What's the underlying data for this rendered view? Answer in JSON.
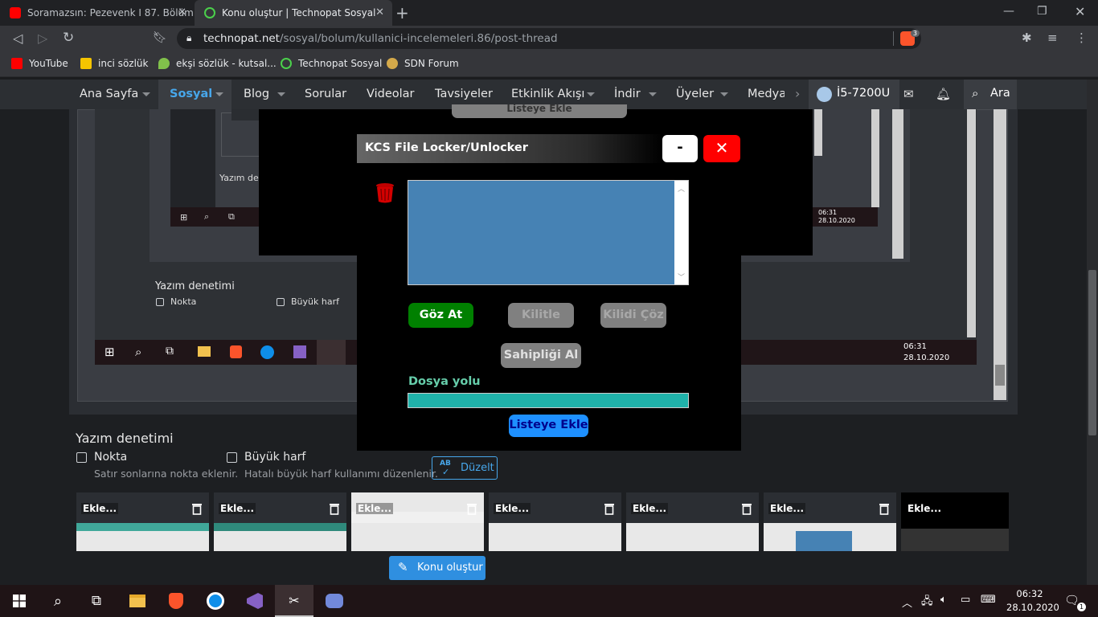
{
  "browser": {
    "tabs": [
      {
        "title": "Soramazsın: Pezevenk I 87. Bölüm"
      },
      {
        "title": "Konu oluştur | Technopat Sosyal"
      }
    ],
    "url_host": "technopat.net",
    "url_path": "/sosyal/bolum/kullanici-incelemeleri.86/post-thread",
    "shield_count": "3",
    "bookmarks": [
      {
        "label": "YouTube"
      },
      {
        "label": "inci sözlük"
      },
      {
        "label": "ekşi sözlük - kutsal..."
      },
      {
        "label": "Technopat Sosyal"
      },
      {
        "label": "SDN Forum"
      }
    ]
  },
  "site": {
    "nav": [
      "Ana Sayfa",
      "Sosyal",
      "Blog",
      "Sorular",
      "Videolar",
      "Tavsiyeler",
      "Etkinlik Akışı",
      "İndir",
      "Üyeler",
      "Medya"
    ],
    "user": "İ5-7200U",
    "search": "Ara",
    "spell": {
      "title": "Yazım denetimi",
      "opt1": "Nokta",
      "opt1_hint": "Satır sonlarına nokta eklenir.",
      "opt2": "Büyük harf",
      "opt2_hint": "Hatalı büyük harf kullanımı düzenlenir.",
      "fix": "Düzelt",
      "fix_icon_text": "AB"
    },
    "thumb_label": "Ekle...",
    "create_button": "Konu oluştur"
  },
  "embedded": {
    "spell_title": "Yazım denetimi",
    "opt1": "Nokta",
    "opt2": "Büyük harf",
    "spell_title_small": "Yazım dene",
    "time": "06:31",
    "date": "28.10.2020"
  },
  "app": {
    "title": "KCS File Locker/Unlocker",
    "min": "-",
    "close": "✕",
    "buttons": {
      "browse": "Göz At",
      "lock": "Kilitle",
      "unlock": "Kilidi Çöz",
      "owner": "Sahipliği Al",
      "add": "Listeye Ekle"
    },
    "path_label": "Dosya yolu",
    "colors": {
      "list": "#4682b4",
      "path": "#20b2aa",
      "browse": "#008000",
      "close": "#ff0000",
      "add": "#1e90ff"
    }
  },
  "taskbar": {
    "time": "06:32",
    "date": "28.10.2020",
    "notif": "1"
  }
}
